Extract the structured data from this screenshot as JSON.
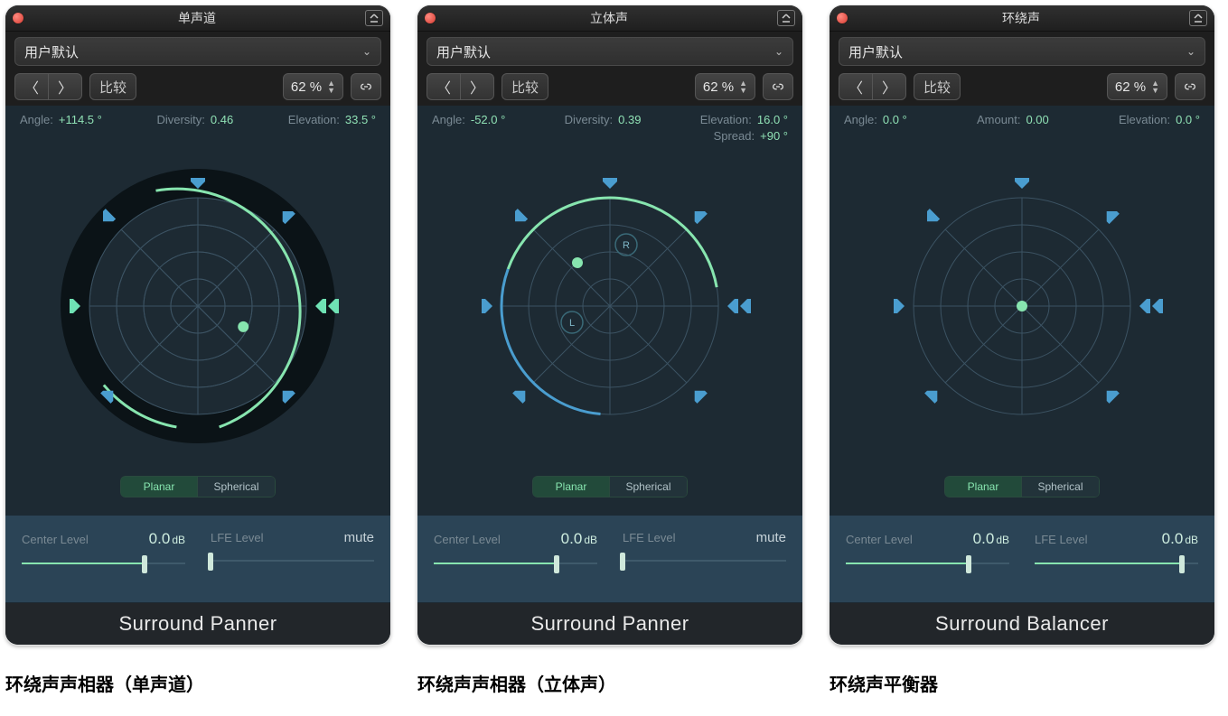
{
  "panels": [
    {
      "title": "单声道",
      "preset": "用户默认",
      "compare": "比较",
      "percent": "62 %",
      "readouts": {
        "angle_label": "Angle:",
        "angle_value": "+114.5 °",
        "mid_label": "Diversity:",
        "mid_value": "0.46",
        "elev_label": "Elevation:",
        "elev_value": "33.5 °"
      },
      "mode": {
        "planar": "Planar",
        "spherical": "Spherical"
      },
      "center": {
        "label": "Center Level",
        "value": "0.0",
        "unit": "dB",
        "fill": 75
      },
      "lfe": {
        "label": "LFE Level",
        "value": "mute",
        "is_mute": true,
        "fill": 0
      },
      "footer": "Surround Panner",
      "caption": "环绕声声相器（单声道）",
      "pan": {
        "style": "mono",
        "angle_deg": 114.5,
        "diversity": 0.46
      }
    },
    {
      "title": "立体声",
      "preset": "用户默认",
      "compare": "比较",
      "percent": "62 %",
      "readouts": {
        "angle_label": "Angle:",
        "angle_value": "-52.0 °",
        "mid_label": "Diversity:",
        "mid_value": "0.39",
        "elev_label": "Elevation:",
        "elev_value": "16.0 °",
        "spread_label": "Spread:",
        "spread_value": "+90 °"
      },
      "mode": {
        "planar": "Planar",
        "spherical": "Spherical"
      },
      "center": {
        "label": "Center Level",
        "value": "0.0",
        "unit": "dB",
        "fill": 75
      },
      "lfe": {
        "label": "LFE Level",
        "value": "mute",
        "is_mute": true,
        "fill": 0
      },
      "footer": "Surround Panner",
      "caption": "环绕声声相器（立体声）",
      "pan": {
        "style": "stereo"
      }
    },
    {
      "title": "环绕声",
      "preset": "用户默认",
      "compare": "比较",
      "percent": "62 %",
      "readouts": {
        "angle_label": "Angle:",
        "angle_value": "0.0 °",
        "mid_label": "Amount:",
        "mid_value": "0.00",
        "elev_label": "Elevation:",
        "elev_value": "0.0 °"
      },
      "mode": {
        "planar": "Planar",
        "spherical": "Spherical"
      },
      "center": {
        "label": "Center Level",
        "value": "0.0",
        "unit": "dB",
        "fill": 75
      },
      "lfe": {
        "label": "LFE Level",
        "value": "0.0",
        "unit": "dB",
        "fill": 90
      },
      "footer": "Surround Balancer",
      "caption": "环绕声平衡器",
      "pan": {
        "style": "balancer"
      }
    }
  ]
}
